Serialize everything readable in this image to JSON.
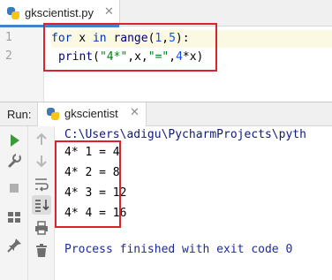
{
  "editor": {
    "tab_label": "gkscientist.py",
    "line_numbers": [
      "1",
      "2"
    ],
    "line1": {
      "kw_for": "for",
      "var": " x ",
      "kw_in": "in",
      "sp": " ",
      "fn": "range",
      "open": "(",
      "n1": "1",
      "comma": ",",
      "n2": "5",
      "close": "):"
    },
    "line2": {
      "fn": "print",
      "open": "(",
      "str1": "\"4*\"",
      "mid1": ",x,",
      "str2": "\"=\"",
      "comma": ",",
      "num": "4",
      "tail": "*x)"
    }
  },
  "run_panel": {
    "label": "Run:",
    "tab_label": "gkscientist",
    "path": "C:\\Users\\adigu\\PycharmProjects\\pyth",
    "output_lines": [
      "4* 1 = 4",
      "4* 2 = 8",
      "4* 3 = 12",
      "4* 4 = 16"
    ],
    "exit_message": "Process finished with exit code 0"
  },
  "icons": {
    "run": "play-icon",
    "up": "arrow-up-icon",
    "down": "arrow-down-icon",
    "wrench": "wrench-icon",
    "stop": "stop-icon",
    "soft_wrap": "soft-wrap-icon",
    "scroll_to_end": "scroll-to-end-icon",
    "layout": "layout-icon",
    "print": "print-icon",
    "pin": "pin-icon",
    "delete": "trash-icon"
  },
  "colors": {
    "highlight_box": "#d9232e",
    "accent_tab": "#4083c9",
    "play": "#3a9a3a"
  }
}
